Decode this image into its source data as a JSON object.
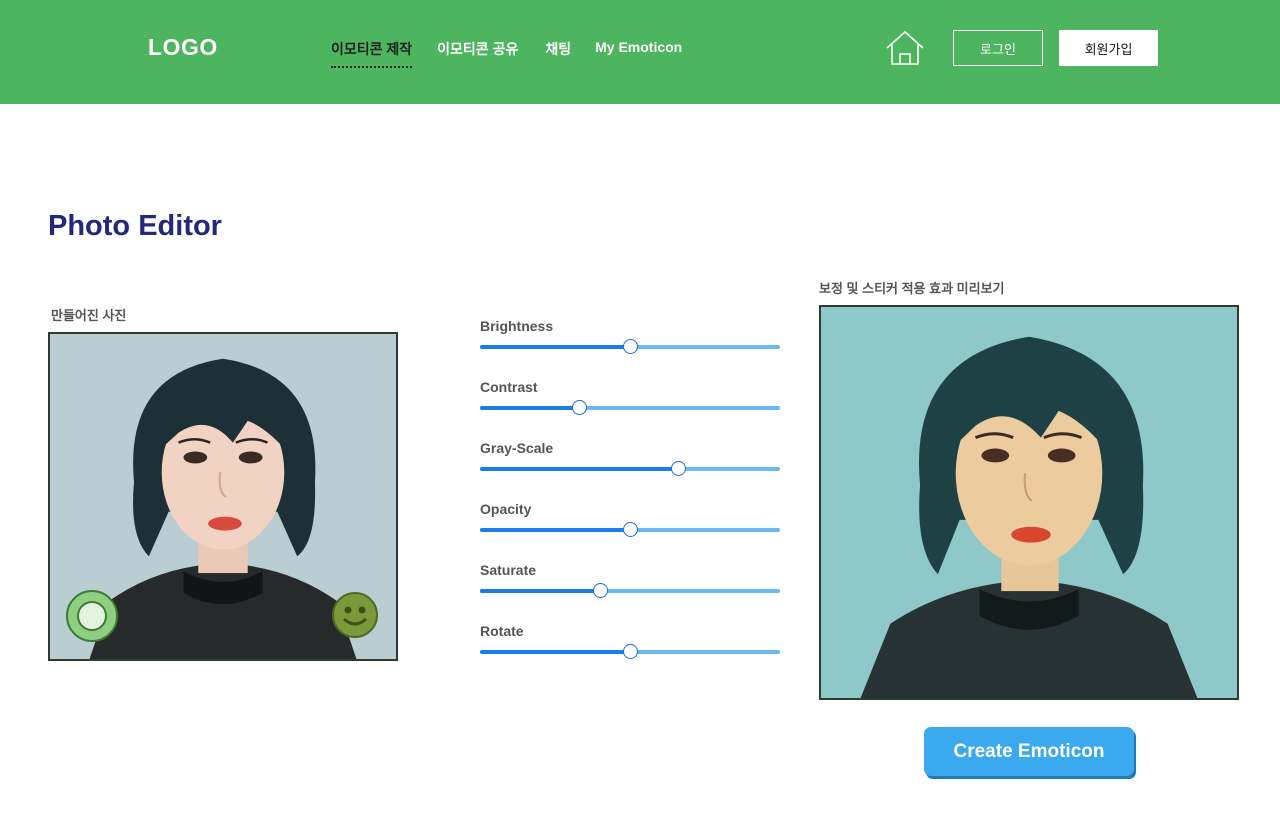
{
  "header": {
    "logo": "LOGO",
    "nav": [
      "이모티콘 제작",
      "이모티콘 공유",
      "채팅",
      "My Emoticon"
    ],
    "active_nav": "이모티콘 제작",
    "home_icon": "home-icon",
    "login_label": "로그인",
    "signup_label": "회원가입",
    "bg_color": "#4db560"
  },
  "main": {
    "title": "Photo Editor",
    "left_label": "만들어진 사진",
    "right_label": "보정 및 스티커 적용 효과 미리보기",
    "create_button": "Create Emoticon",
    "stickers": [
      "circle-sticker",
      "smiley-sticker"
    ]
  },
  "sliders": [
    {
      "label": "Brightness",
      "value": 0.5
    },
    {
      "label": "Contrast",
      "value": 0.33
    },
    {
      "label": "Gray-Scale",
      "value": 0.66
    },
    {
      "label": "Opacity",
      "value": 0.5
    },
    {
      "label": "Saturate",
      "value": 0.4
    },
    {
      "label": "Rotate",
      "value": 0.5
    }
  ],
  "colors": {
    "title": "#24287a",
    "slider_fill": "#1a7ee6",
    "slider_track": "#6cb8f2",
    "button": "#3aa9ef"
  }
}
